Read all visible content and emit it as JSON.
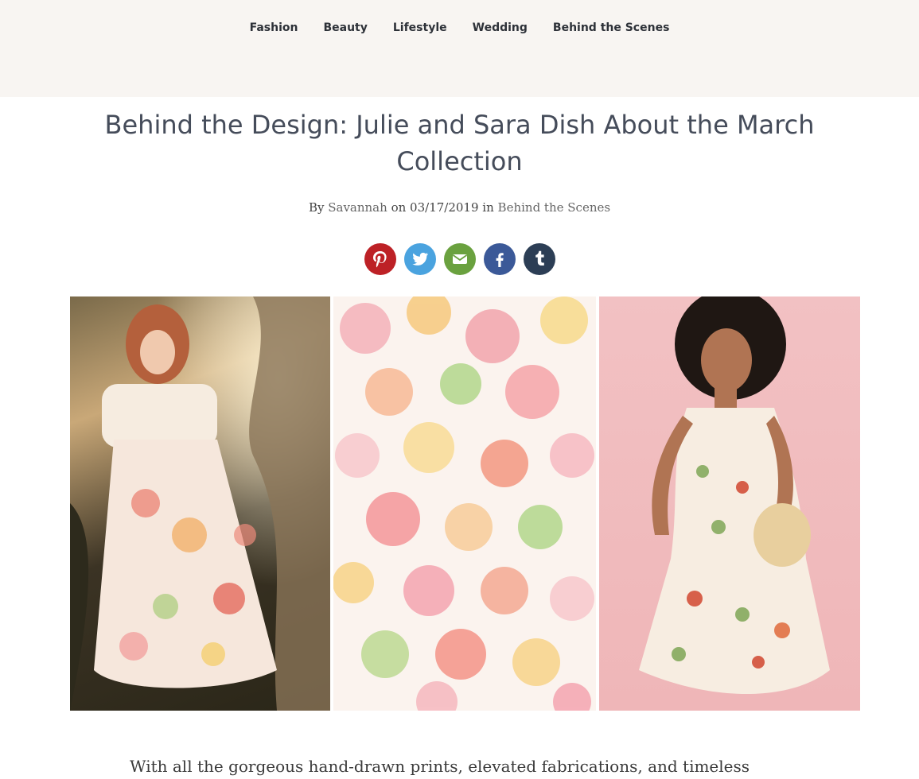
{
  "nav": {
    "items": [
      "Fashion",
      "Beauty",
      "Lifestyle",
      "Wedding",
      "Behind the Scenes"
    ]
  },
  "article": {
    "title": "Behind the Design: Julie and Sara Dish About the March Collection",
    "byline_by": "By",
    "author": "Savannah",
    "byline_on": "on",
    "date": "03/17/2019",
    "byline_in": "in",
    "category": "Behind the Scenes",
    "intro": "With all the gorgeous hand-drawn prints, elevated fabrications, and timeless"
  },
  "share": [
    {
      "icon": "pinterest-icon",
      "color": "#bd2126"
    },
    {
      "icon": "twitter-icon",
      "color": "#4aa3df"
    },
    {
      "icon": "email-icon",
      "color": "#6aa13f"
    },
    {
      "icon": "facebook-icon",
      "color": "#3b5998"
    },
    {
      "icon": "tumblr-icon",
      "color": "#2c3e55"
    }
  ]
}
